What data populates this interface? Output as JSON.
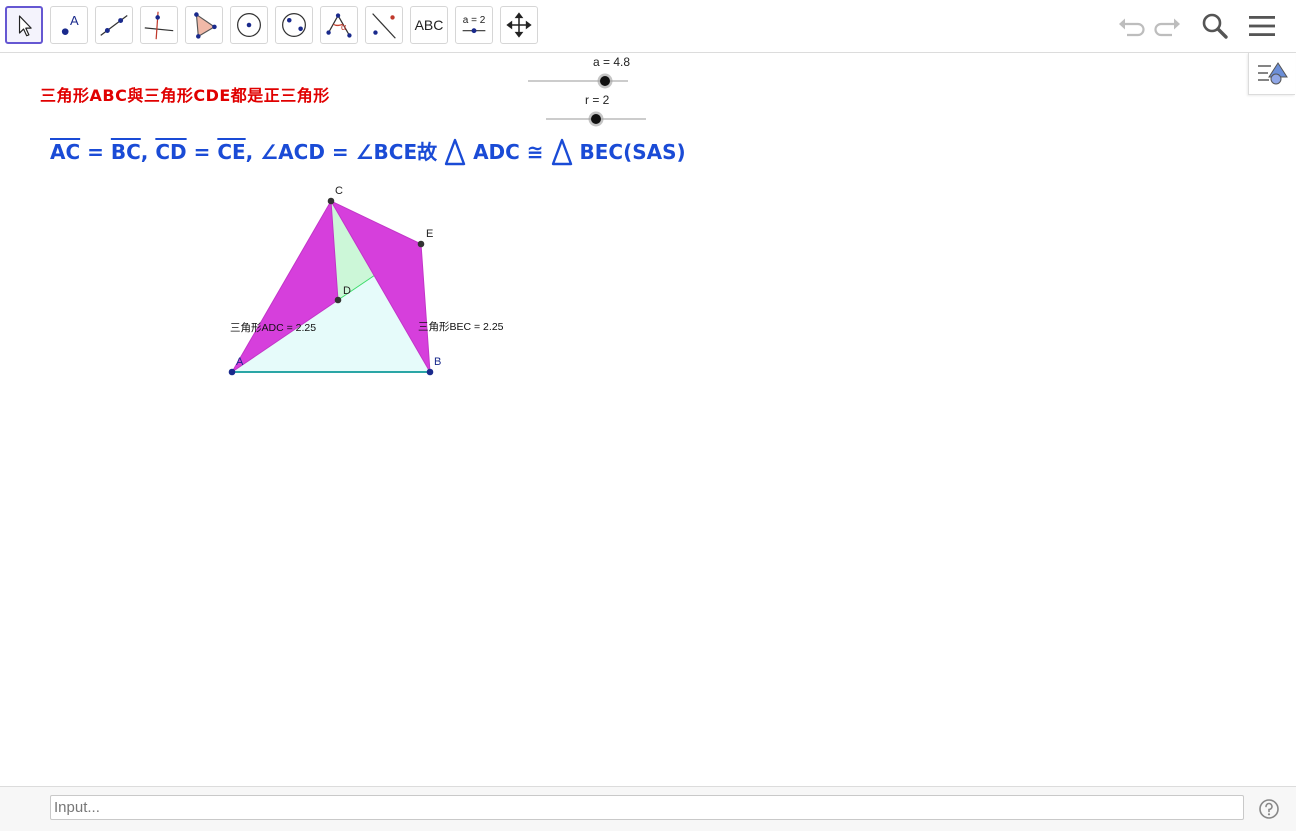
{
  "toolbar": {
    "tools": [
      {
        "name": "move-tool"
      },
      {
        "name": "point-tool",
        "label": "A"
      },
      {
        "name": "line-tool"
      },
      {
        "name": "perpendicular-tool"
      },
      {
        "name": "polygon-tool"
      },
      {
        "name": "circle-tool"
      },
      {
        "name": "ellipse-tool"
      },
      {
        "name": "angle-tool",
        "label": "α"
      },
      {
        "name": "reflect-tool"
      },
      {
        "name": "text-tool",
        "label": "ABC"
      },
      {
        "name": "slider-tool",
        "label": "a = 2"
      },
      {
        "name": "move-graphics-view-tool"
      }
    ],
    "undo_icon": "undo-icon",
    "redo_icon": "redo-icon",
    "search_icon": "search-icon",
    "menu_icon": "menu-icon"
  },
  "graphics": {
    "title": "三角形ABC與三角形CDE都是正三角形",
    "proof": {
      "seg1": "AC",
      "eq": "=",
      "seg2": "BC",
      "comma1": ", ",
      "seg3": "CD",
      "seg4": "CE",
      "angles": ", ∠ACD = ∠BCE故",
      "tri1": "ADC",
      "congruent": "≅",
      "tri2": "BEC(SAS)"
    },
    "slider_a": {
      "label": "a = 4.8",
      "value": 4.8
    },
    "slider_r": {
      "label": "r = 2",
      "value": 2
    },
    "points": {
      "A": "A",
      "B": "B",
      "C": "C",
      "D": "D",
      "E": "E"
    },
    "area_adc": "三角形ADC = 2.25",
    "area_bec": "三角形BEC = 2.25"
  },
  "colors": {
    "accent": "#6557d2",
    "title_red": "#e00000",
    "proof_blue": "#1a4bd6",
    "magenta_fill": "#d63fdc",
    "cyan_fill": "#e6fbfa",
    "green_fill": "#ccf7d8",
    "segment_teal": "#0e9a9a"
  },
  "input": {
    "placeholder": "Input..."
  },
  "help_icon": "help-icon",
  "stylebar_icon": "graphics-stylebar-icon"
}
